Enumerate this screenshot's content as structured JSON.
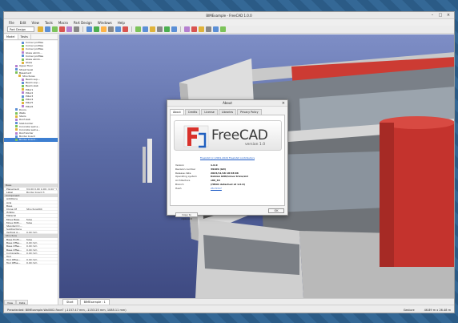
{
  "window": {
    "title": "BIMExample - FreeCAD 1.0.0"
  },
  "menubar": {
    "items": [
      "File",
      "Edit",
      "View",
      "Tools",
      "Macro",
      "Part Design",
      "Windows",
      "Help"
    ]
  },
  "toolbar": {
    "workbench": "Part Design",
    "icon_colors": [
      "#e0b33a",
      "#5b8fd6",
      "#7cc35a",
      "#d9534f",
      "#b57fd0",
      "#888888",
      "#5b8fd6",
      "#4caf50",
      "#ffb347",
      "#888888",
      "#5b8fd6",
      "#d9534f",
      "#7cc35a",
      "#5b8fd6",
      "#e0b33a",
      "#888888",
      "#4caf50",
      "#5b8fd6",
      "#b57fd0",
      "#d9534f",
      "#e0b33a",
      "#888888",
      "#5b8fd6",
      "#7cc35a"
    ]
  },
  "left_panel": {
    "tabs": [
      "Model",
      "Tasks"
    ],
    "tree": [
      "Corner profiles",
      "Corner profiles",
      "Corner profiles",
      "Glass windo...",
      "Corner profiles",
      "Glass windo...",
      "Glass",
      "Upper floor",
      "Street level",
      "Basement",
      "Structures",
      "Beam sup...",
      "Beam sup...",
      "Beam slab",
      "Pillar1",
      "Pillar2",
      "Pillar3",
      "Pillar4",
      "Pillar5",
      "Pillar6",
      "Doors",
      "Walls",
      "Stairs",
      "Roof slab",
      "Slab border",
      "Concrete wall a...",
      "Concrete wall a...",
      "Roof border",
      "Border board",
      "Border board..."
    ],
    "selected_index": 29,
    "property_groups": [
      {
        "name": "Base",
        "rows": [
          [
            "Placement",
            "[(0.00 0.00 1.00); 0.00 °]"
          ],
          [
            "Label",
            "Border board 3"
          ]
        ]
      },
      {
        "name": "Component",
        "rows": [
          [
            "Additions",
            ""
          ],
          [
            "Axis",
            ""
          ],
          [
            "Base",
            ""
          ],
          [
            "Clone Of",
            "Structure004"
          ],
          [
            "IfcRole",
            ""
          ],
          [
            "Material",
            ""
          ],
          [
            "Move Base",
            "false"
          ],
          [
            "Move With...",
            "false"
          ],
          [
            "Standard C...",
            ""
          ],
          [
            "Subtractions",
            ""
          ],
          [
            "Vertical A...",
            "0.00 mm"
          ]
        ]
      },
      {
        "name": "Structure",
        "rows": [
          [
            "Base Profil...",
            "false"
          ],
          [
            "Base Offse...",
            "0.00 mm"
          ],
          [
            "Base Offse...",
            "0.00 mm"
          ],
          [
            "Base Offse...",
            "0.00 mm"
          ],
          [
            "Composite...",
            "0.00 mm"
          ],
          [
            "Tool",
            ""
          ],
          [
            "Tool Offse...",
            "0.00 mm"
          ],
          [
            "Tool Offse...",
            "0.00 mm"
          ]
        ]
      }
    ],
    "bottom_tabs": [
      "View",
      "Data"
    ]
  },
  "viewport": {
    "tabs": [
      "Start",
      "BIMExample : 1"
    ]
  },
  "statusbar": {
    "left": "Preselected: BIMExample.Wall002.Face7 (-1157.47 mm, -1153.25 mm, 1085.11 mm)",
    "navigation": "Gesture",
    "dimensions": "46.89 m x 26.48 m"
  },
  "about_dialog": {
    "title": "About",
    "tabs": [
      "About",
      "Credits",
      "License",
      "Libraries",
      "Privacy Policy"
    ],
    "brand": "FreeCAD",
    "version_caption": "version 1.0",
    "copyright": "FreeCAD (c) 2001-2024 FreeCAD contributors",
    "info": [
      {
        "key": "Version",
        "value": "1.0.0"
      },
      {
        "key": "Revision number",
        "value": "39109 (Git)"
      },
      {
        "key": "Release date",
        "value": "2024/11/18 18:48:06"
      },
      {
        "key": "Operating system",
        "value": "Debian GNU/Linux trixie/sid"
      },
      {
        "key": "Architecture",
        "value": "x86_64"
      },
      {
        "key": "Branch",
        "value": "(HEAD detached at 1.0.0)"
      },
      {
        "key": "Hash",
        "value": "2fcc5317"
      }
    ],
    "copy_button": "Copy to clipboard",
    "ok_button": "OK"
  }
}
